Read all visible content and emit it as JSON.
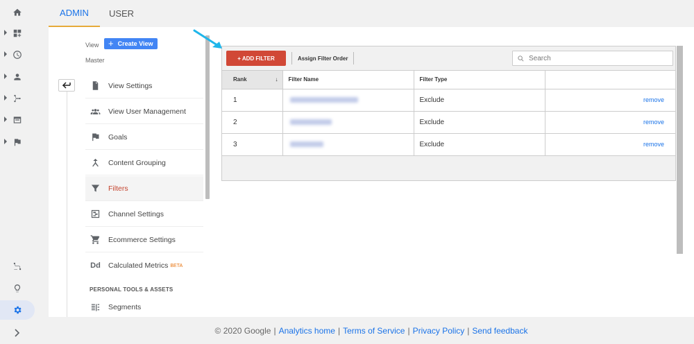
{
  "tabs": {
    "admin": "ADMIN",
    "user": "USER"
  },
  "view_nav": {
    "view_label": "View",
    "create_view": "Create View",
    "view_name": "Master",
    "items": [
      {
        "label": "View Settings",
        "icon": "document-icon"
      },
      {
        "label": "View User Management",
        "icon": "people-icon"
      },
      {
        "label": "Goals",
        "icon": "flag-icon"
      },
      {
        "label": "Content Grouping",
        "icon": "merge-icon"
      },
      {
        "label": "Filters",
        "icon": "funnel-icon"
      },
      {
        "label": "Channel Settings",
        "icon": "channel-icon"
      },
      {
        "label": "Ecommerce Settings",
        "icon": "cart-icon"
      },
      {
        "label": "Calculated Metrics",
        "icon": "dd-icon",
        "badge": "BETA"
      }
    ],
    "section_head": "PERSONAL TOOLS & ASSETS",
    "segments": {
      "label": "Segments",
      "icon": "segments-icon"
    }
  },
  "toolbar": {
    "add_filter": "+ ADD FILTER",
    "assign_order": "Assign Filter Order",
    "search_placeholder": "Search"
  },
  "table": {
    "headers": {
      "rank": "Rank",
      "name": "Filter Name",
      "type": "Filter Type"
    },
    "sort_arrow": "↓",
    "rows": [
      {
        "rank": "1",
        "type": "Exclude",
        "action": "remove"
      },
      {
        "rank": "2",
        "type": "Exclude",
        "action": "remove"
      },
      {
        "rank": "3",
        "type": "Exclude",
        "action": "remove"
      }
    ]
  },
  "footer": {
    "copyright": "© 2020 Google",
    "links": [
      "Analytics home",
      "Terms of Service",
      "Privacy Policy",
      "Send feedback"
    ]
  },
  "colors": {
    "accent_blue": "#1a73e8",
    "add_filter_red": "#d14836",
    "active_nav_text": "#c4432d",
    "create_view_blue": "#4285f4",
    "annotation_arrow": "#1fb6ea"
  }
}
